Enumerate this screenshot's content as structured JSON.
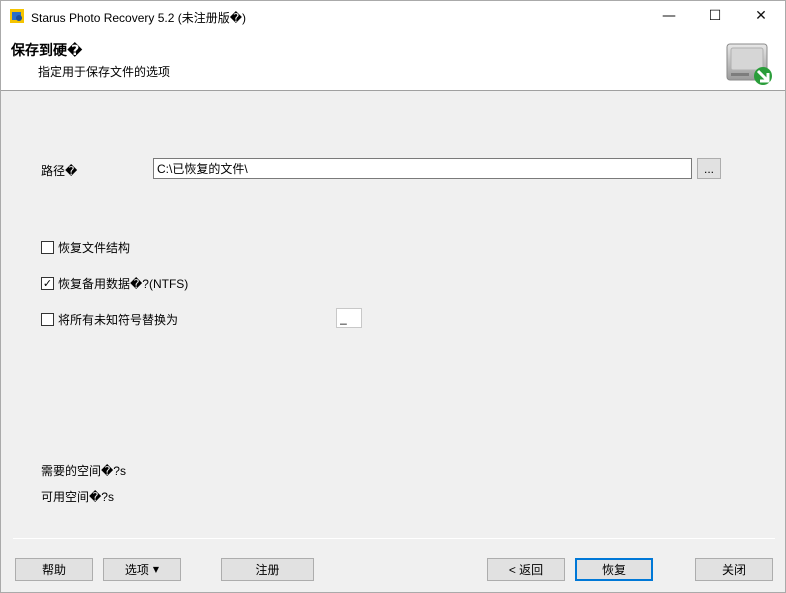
{
  "window": {
    "title": "Starus Photo Recovery 5.2 (未注册版�)",
    "minimize": "—",
    "maximize": "☐",
    "close": "✕"
  },
  "header": {
    "title": "保存到硬�",
    "subtitle": "指定用于保存文件的选项",
    "icon": "drive-save-icon"
  },
  "form": {
    "path_label": "路径�",
    "path_value": "C:\\已恢复的文件\\",
    "browse_label": "...",
    "options": [
      {
        "label": "恢复文件结构",
        "checked": false
      },
      {
        "label": "恢复备用数据�?(NTFS)",
        "checked": true
      },
      {
        "label": "将所有未知符号替换为",
        "checked": false
      }
    ],
    "replace_char": "_"
  },
  "space": {
    "required": "需要的空间�?s",
    "available": "可用空间�?s"
  },
  "buttons": {
    "help": "帮助",
    "options": "选项",
    "register": "注册",
    "back": "< 返回",
    "recover": "恢复",
    "close": "关闭"
  },
  "colors": {
    "accent": "#0078d7",
    "header_bg": "#ffffff",
    "window_bg": "#f0f0f0"
  }
}
